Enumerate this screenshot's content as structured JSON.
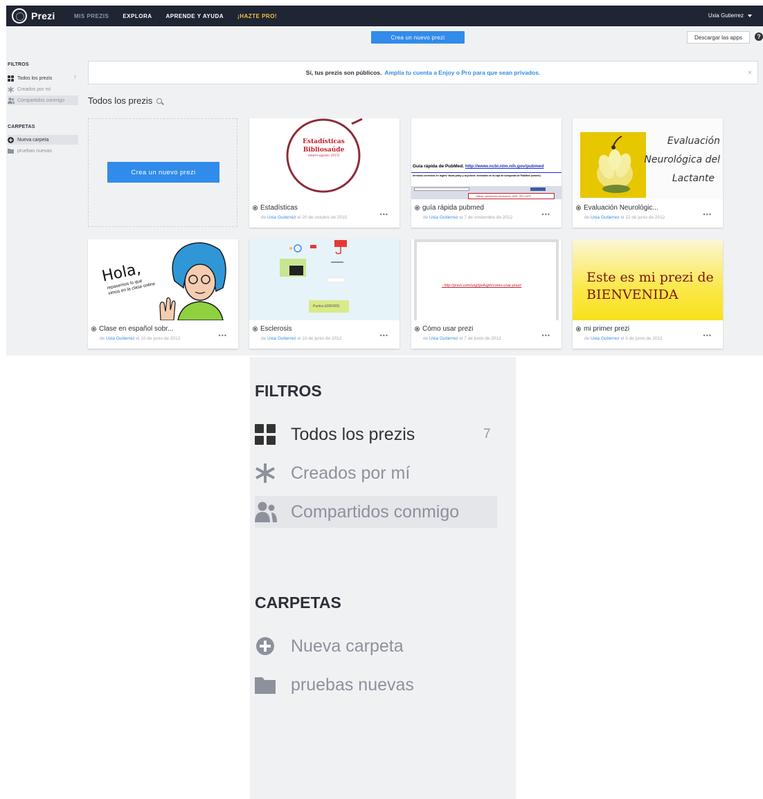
{
  "topnav": {
    "logo_text": "Prezi",
    "items": [
      "MIS PREZIS",
      "EXPLORA",
      "APRENDE Y AYUDA",
      "¡HAZTE PRO!"
    ],
    "user": "Uxia Gutierrez"
  },
  "subbar": {
    "create_label": "Crea un nuevo prezi",
    "download_label": "Descargar las apps",
    "help_label": "?"
  },
  "sidebar": {
    "filters_heading": "FILTROS",
    "filters": [
      {
        "label": "Todos los prezis",
        "count": "7"
      },
      {
        "label": "Creados por mí"
      },
      {
        "label": "Compartidos conmigo"
      }
    ],
    "folders_heading": "CARPETAS",
    "folders": [
      {
        "label": "Nueva carpeta"
      },
      {
        "label": "pruebas nuevas"
      }
    ]
  },
  "banner": {
    "text": "Sí, tus prezis son públicos.",
    "link": "Amplía tu cuenta a Enjoy o Pro para que sean privados.",
    "close": "×"
  },
  "main": {
    "section_title": "Todos los prezis",
    "new_card_label": "Crea un nuevo prezi"
  },
  "cards": [
    {
      "title": "Estadísticas",
      "author": "Uxia Gutierrez",
      "date": "el 20 de octubre de 2015",
      "by": "de"
    },
    {
      "title": "guía rápida pubmed",
      "author": "Uxia Gutierrez",
      "date": "el 7 de noviembre de 2012",
      "by": "de"
    },
    {
      "title": "Evaluación Neurológic...",
      "author": "Uxia Gutierrez",
      "date": "el 12 de junio de 2012",
      "by": "de"
    },
    {
      "title": "Clase en español sobr...",
      "author": "Uxia Gutierrez",
      "date": "el 10 de junio de 2012",
      "by": "de"
    },
    {
      "title": "Esclerosis",
      "author": "Uxia Gutierrez",
      "date": "el 10 de junio de 2012",
      "by": "de"
    },
    {
      "title": "Cómo usar prezi",
      "author": "Uxia Gutierrez",
      "date": "el 7 de junio de 2012",
      "by": "de"
    },
    {
      "title": "mi primer prezi",
      "author": "Uxia Gutierrez",
      "date": "el 5 de junio de 2012",
      "by": "de"
    }
  ],
  "thumbs": {
    "estadisticas_title": "Estadísticas",
    "estadisticas_sub": "Bibliosaúde",
    "estadisticas_date": "(enero-agosto 2015)",
    "pubmed_heading": "Guía rápida de PubMed.",
    "pubmed_link": "http://www.ncbi.nlm.nih.gov/pubmed",
    "pubmed_line": "términos correctos en inglés: facial palsy y acyclovir; tecleados en la caja de búsqueda de PubMed (search):",
    "pubmed_box": "Utilizar operadores booleanos: AND, OR y NOT",
    "eval_line1": "Evaluación",
    "eval_line2": "Neurológica del",
    "eval_line3": "Lactante",
    "hola_big": "Hola,",
    "hola_small1": "repasemos lo que",
    "hola_small2": "vimos en la clase online",
    "esclerosis_note": "Puntos ERRORS",
    "comousar_link": "- http://prezi.com/uzg6ja4ugm/como-usar-prezi/",
    "bienvenida_line1": "Este es mi prezi de",
    "bienvenida_line2": "BIENVENIDA"
  },
  "colors": {
    "accent": "#318bea",
    "nav_bg": "#1f2532",
    "pro": "#f3c244",
    "page_bg": "#f0f1f3"
  },
  "more_label": "•••"
}
